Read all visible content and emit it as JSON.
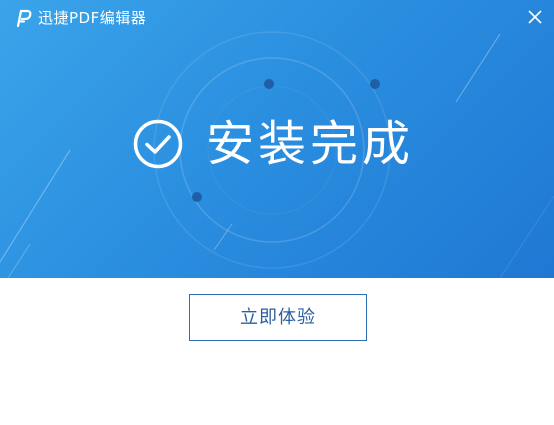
{
  "window": {
    "title": "迅捷PDF编辑器"
  },
  "hero": {
    "status_text": "安装完成"
  },
  "footer": {
    "action_label": "立即体验"
  },
  "icons": {
    "app_logo": "app-logo-icon",
    "close": "close-icon",
    "success": "check-circle-icon"
  },
  "colors": {
    "hero_start": "#3aa4ea",
    "hero_end": "#1f78d3",
    "button_border": "#2c6fb3",
    "button_text": "#2c5f9e"
  }
}
